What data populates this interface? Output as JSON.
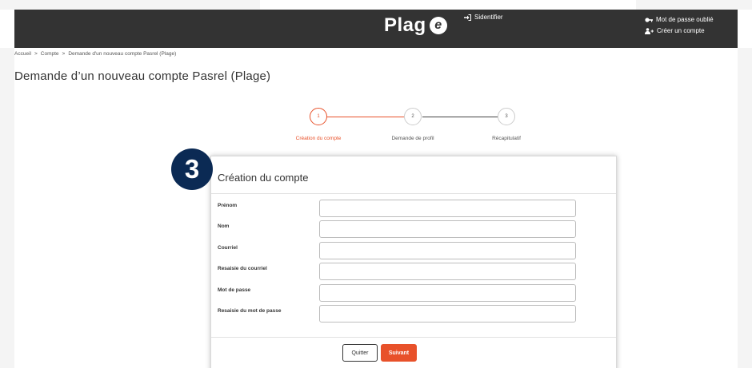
{
  "header": {
    "logo_text": "Plag",
    "logo_letter": "e",
    "login_label": "Sidentifier",
    "forgot_password_label": "Mot de passe oublié",
    "create_account_label": "Créer un compte"
  },
  "breadcrumb": {
    "items": [
      "Accueil",
      "Compte",
      "Demande d'un nouveau compte Pasrel (Plage)"
    ],
    "separator": ">"
  },
  "page_title": "Demande d’un nouveau compte Pasrel (Plage)",
  "stepper": {
    "steps": [
      {
        "number": "1",
        "label": "Création du compte",
        "active": true
      },
      {
        "number": "2",
        "label": "Demande de profil",
        "active": false
      },
      {
        "number": "3",
        "label": "Récapitulatif",
        "active": false
      }
    ]
  },
  "badge": "3",
  "form": {
    "title": "Création du compte",
    "fields": [
      {
        "label": "Prénom",
        "value": ""
      },
      {
        "label": "Nom",
        "value": ""
      },
      {
        "label": "Courriel",
        "value": ""
      },
      {
        "label": "Resaisie du courriel",
        "value": ""
      },
      {
        "label": "Mot de passe",
        "value": ""
      },
      {
        "label": "Resaisie du mot de passe",
        "value": ""
      }
    ],
    "quit_label": "Quitter",
    "next_label": "Suivant"
  },
  "colors": {
    "accent": "#e8512a",
    "header_bg": "#333333",
    "badge_bg": "#0b2a54"
  },
  "icons": [
    "sign-in-icon",
    "key-icon",
    "user-plus-icon"
  ]
}
